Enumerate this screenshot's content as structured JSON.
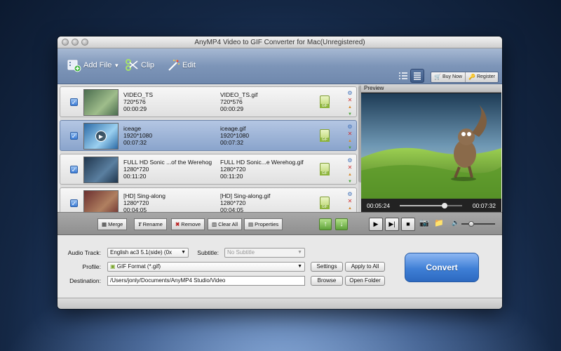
{
  "window": {
    "title": "AnyMP4 Video to GIF Converter for Mac(Unregistered)"
  },
  "toolbar": {
    "add_file": "Add File",
    "clip": "Clip",
    "edit": "Edit",
    "buy_now": "Buy Now",
    "register": "Register"
  },
  "files": [
    {
      "name": "VIDEO_TS",
      "resolution": "720*576",
      "duration": "00:00:29",
      "output_name": "VIDEO_TS.gif",
      "output_resolution": "720*576",
      "output_duration": "00:00:29",
      "checked": true,
      "selected": false
    },
    {
      "name": "iceage",
      "resolution": "1920*1080",
      "duration": "00:07:32",
      "output_name": "iceage.gif",
      "output_resolution": "1920*1080",
      "output_duration": "00:07:32",
      "checked": true,
      "selected": true
    },
    {
      "name": "FULL HD Sonic ...of the Werehog",
      "resolution": "1280*720",
      "duration": "00:11:20",
      "output_name": "FULL HD Sonic...e Werehog.gif",
      "output_resolution": "1280*720",
      "output_duration": "00:11:20",
      "checked": true,
      "selected": false
    },
    {
      "name": "[HD] Sing-along",
      "resolution": "1280*720",
      "duration": "00:04:05",
      "output_name": "[HD] Sing-along.gif",
      "output_resolution": "1280*720",
      "output_duration": "00:04:05",
      "checked": true,
      "selected": false
    }
  ],
  "gif_badge": "GIF",
  "preview": {
    "label": "Preview",
    "current_time": "00:05:24",
    "total_time": "00:07:32",
    "progress": 0.72
  },
  "actions": {
    "merge": "Merge",
    "rename": "Rename",
    "remove": "Remove",
    "clear_all": "Clear All",
    "properties": "Properties"
  },
  "settings": {
    "audio_track_label": "Audio Track:",
    "audio_track_value": "English ac3 5.1(side) (0x",
    "subtitle_label": "Subtitle:",
    "subtitle_value": "No Subtitle",
    "profile_label": "Profile:",
    "profile_value": "GIF Format (*.gif)",
    "settings_button": "Settings",
    "apply_all_button": "Apply to All",
    "destination_label": "Destination:",
    "destination_value": "/Users/jonly/Documents/AnyMP4 Studio/Video",
    "browse_button": "Browse",
    "open_folder_button": "Open Folder",
    "convert_button": "Convert"
  },
  "colors": {
    "accent": "#3f7fd6",
    "toolbar": "#7d95b8",
    "selected_row": "#8aa4cc"
  }
}
